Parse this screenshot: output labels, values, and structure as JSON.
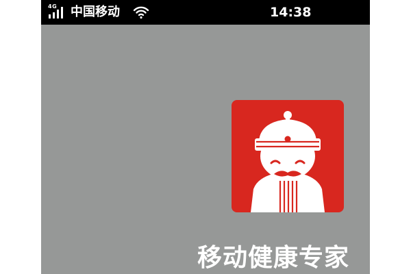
{
  "status_bar": {
    "network": "4G",
    "carrier": "中国移动",
    "time": "14:38",
    "signal_bars": 4,
    "icons": [
      "signal-icon",
      "wifi-icon"
    ]
  },
  "app": {
    "title": "移动健康专家",
    "icon": "elder-doctor-icon"
  },
  "colors": {
    "background": "#969897",
    "status_bar": "#000000",
    "icon_red": "#d8271f",
    "text": "#ffffff"
  }
}
